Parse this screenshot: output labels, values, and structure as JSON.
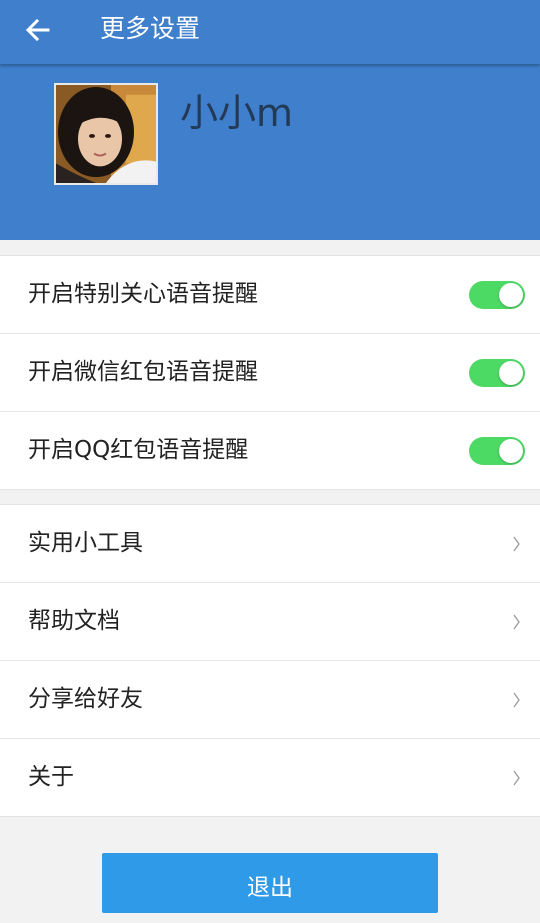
{
  "appbar": {
    "title": "更多设置",
    "back_icon": "arrow-left-icon"
  },
  "profile": {
    "username": "小小m"
  },
  "toggles": [
    {
      "label": "开启特别关心语音提醒",
      "on": true
    },
    {
      "label": "开启微信红包语音提醒",
      "on": true
    },
    {
      "label": "开启QQ红包语音提醒",
      "on": true
    }
  ],
  "menu": [
    {
      "label": "实用小工具",
      "icon": "chevron-right-icon"
    },
    {
      "label": "帮助文档",
      "icon": "chevron-right-icon"
    },
    {
      "label": "分享给好友",
      "icon": "chevron-right-icon"
    },
    {
      "label": "关于",
      "icon": "chevron-right-icon"
    }
  ],
  "logout": {
    "label": "退出"
  },
  "colors": {
    "header": "#3f7fcc",
    "switch_on": "#4cd964",
    "logout": "#2f9be8"
  }
}
